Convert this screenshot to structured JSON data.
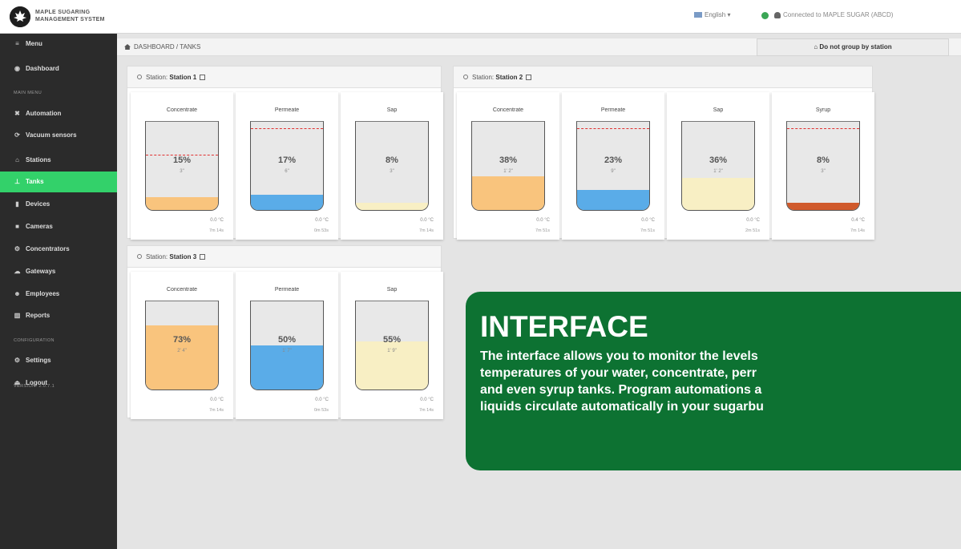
{
  "app": {
    "brand_line1": "MAPLE SUGARING",
    "brand_line2": "MANAGEMENT SYSTEM",
    "language": "English",
    "connection": "Connected to MAPLE SUGAR (ABCD)"
  },
  "sidebar": {
    "items": [
      {
        "label": "Menu",
        "icon": "menu-icon",
        "glyph": "≡"
      },
      {
        "label": "Dashboard",
        "icon": "dashboard-icon",
        "glyph": "◉"
      },
      {
        "label": "Automation",
        "icon": "automation-icon",
        "glyph": "✖"
      },
      {
        "label": "Vacuum sensors",
        "icon": "vacuum-icon",
        "glyph": "⟳"
      },
      {
        "label": "Stations",
        "icon": "home-icon",
        "glyph": "⌂"
      },
      {
        "label": "Tanks",
        "icon": "tank-icon",
        "glyph": "⊥"
      },
      {
        "label": "Devices",
        "icon": "device-icon",
        "glyph": "▮"
      },
      {
        "label": "Cameras",
        "icon": "camera-icon",
        "glyph": "■"
      },
      {
        "label": "Concentrators",
        "icon": "concentrator-icon",
        "glyph": "⚙"
      },
      {
        "label": "Gateways",
        "icon": "gateway-icon",
        "glyph": "☁"
      },
      {
        "label": "Employees",
        "icon": "employees-icon",
        "glyph": "☻"
      },
      {
        "label": "Reports",
        "icon": "reports-icon",
        "glyph": "▥"
      },
      {
        "label": "Settings",
        "icon": "settings-icon",
        "glyph": "⚙"
      },
      {
        "label": "Logout",
        "icon": "logout-icon",
        "glyph": "⏏"
      }
    ],
    "sections": [
      "MAIN MENU",
      "CONFIGURATION"
    ],
    "version": "VERSION: 2.0.7.1",
    "active": "Tanks"
  },
  "breadcrumb": "DASHBOARD / TANKS",
  "group_button": "Do not group by station",
  "stations": [
    {
      "prefix": "Station:",
      "name": "Station 1",
      "tanks": [
        {
          "name": "Concentrate",
          "percent": "15%",
          "level": 0.15,
          "limit": 0.62,
          "height": "3\"",
          "temp": "0.0 °C",
          "time": "7m 14s",
          "color": "#f9c47d"
        },
        {
          "name": "Permeate",
          "percent": "17%",
          "level": 0.17,
          "limit": 0.92,
          "height": "6\"",
          "temp": "0.0 °C",
          "time": "0m 53s",
          "color": "#5aace8"
        },
        {
          "name": "Sap",
          "percent": "8%",
          "level": 0.08,
          "limit": null,
          "height": "3\"",
          "temp": "0.0 °C",
          "time": "7m 14s",
          "color": "#f8efc4"
        }
      ]
    },
    {
      "prefix": "Station:",
      "name": "Station 2",
      "tanks": [
        {
          "name": "Concentrate",
          "percent": "38%",
          "level": 0.38,
          "limit": null,
          "height": "1' 2\"",
          "temp": "0.0 °C",
          "time": "7m 51s",
          "color": "#f9c47d"
        },
        {
          "name": "Permeate",
          "percent": "23%",
          "level": 0.23,
          "limit": 0.92,
          "height": "9\"",
          "temp": "0.0 °C",
          "time": "7m 51s",
          "color": "#5aace8"
        },
        {
          "name": "Sap",
          "percent": "36%",
          "level": 0.36,
          "limit": null,
          "height": "1' 2\"",
          "temp": "0.0 °C",
          "time": "2m 51s",
          "color": "#f8efc4"
        },
        {
          "name": "Syrup",
          "percent": "8%",
          "level": 0.08,
          "limit": 0.92,
          "height": "3\"",
          "temp": "0.4 °C",
          "time": "7m 14s",
          "color": "#d05a2c"
        }
      ]
    },
    {
      "prefix": "Station:",
      "name": "Station 3",
      "tanks": [
        {
          "name": "Concentrate",
          "percent": "73%",
          "level": 0.73,
          "limit": null,
          "height": "2' 4\"",
          "temp": "0.0 °C",
          "time": "7m 14s",
          "color": "#f9c47d"
        },
        {
          "name": "Permeate",
          "percent": "50%",
          "level": 0.5,
          "limit": null,
          "height": "1' 7\"",
          "temp": "0.0 °C",
          "time": "0m 53s",
          "color": "#5aace8"
        },
        {
          "name": "Sap",
          "percent": "55%",
          "level": 0.55,
          "limit": null,
          "height": "1' 9\"",
          "temp": "0.0 °C",
          "time": "7m 14s",
          "color": "#f8efc4"
        }
      ]
    }
  ],
  "overlay": {
    "title": "INTERFACE",
    "lines": [
      "The interface allows you to monitor the levels",
      "temperatures of your water, concentrate, perr",
      "and even syrup tanks. Program automations a",
      "liquids circulate automatically in your sugarbu"
    ]
  }
}
